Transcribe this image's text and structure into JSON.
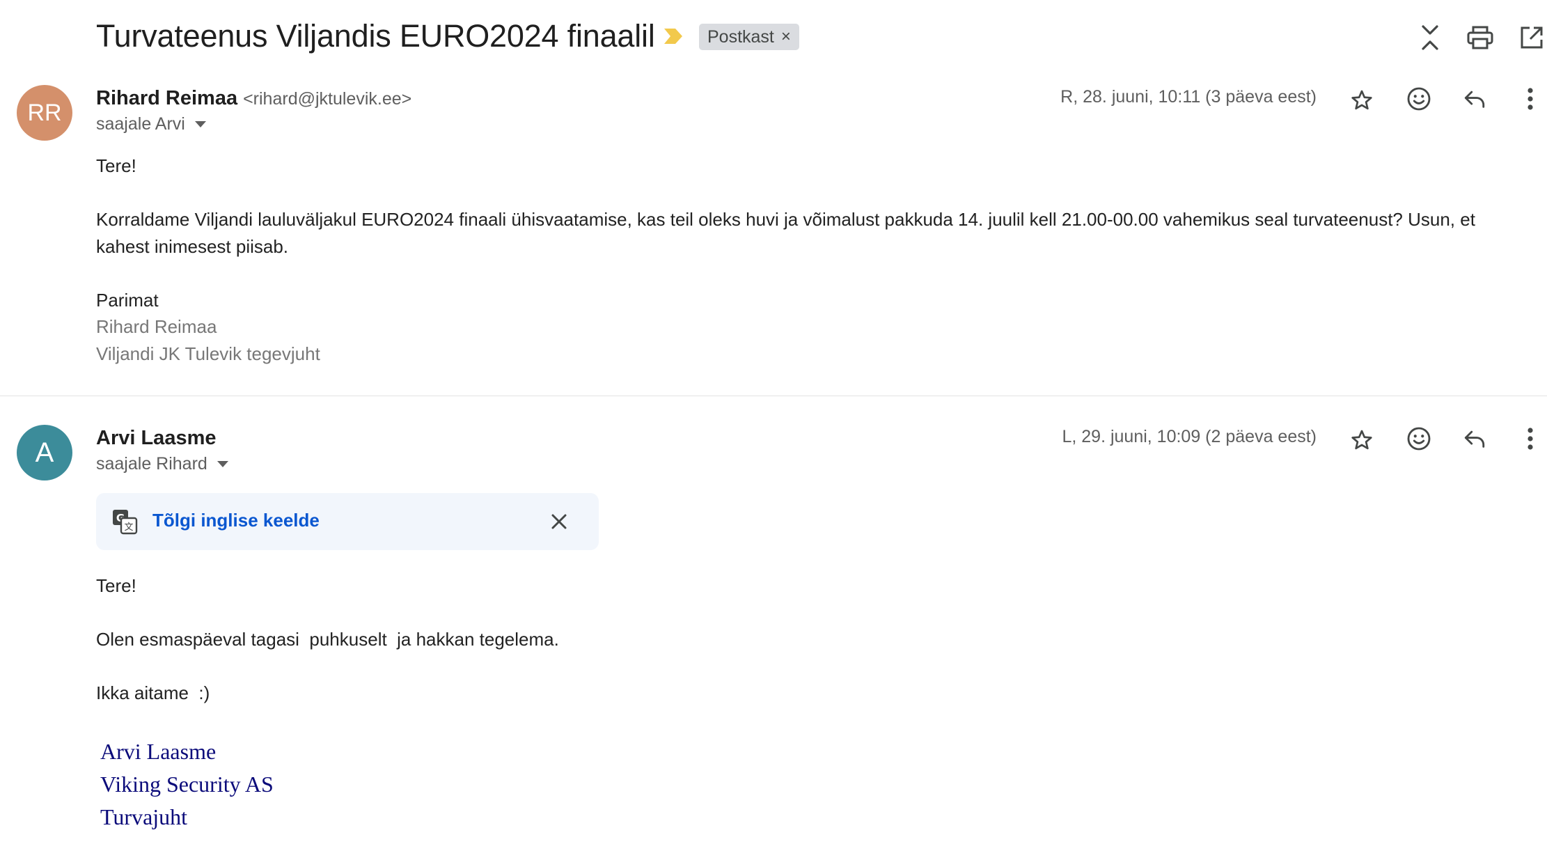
{
  "thread": {
    "subject": "Turvateenus Viljandis EURO2024 finaalil",
    "label": "Postkast",
    "label_remove": "×",
    "toolbar_icons": [
      "collapse-all-icon",
      "print-icon",
      "open-in-new-window-icon"
    ]
  },
  "colors": {
    "avatar_rr": "#d4906b",
    "avatar_a": "#3c8c9a",
    "importance": "#f2c94c",
    "link": "#0b57d0",
    "signature": "#0b0b7a"
  },
  "messages": [
    {
      "avatar_initials": "RR",
      "sender_name": "Rihard Reimaa",
      "sender_email": "<rihard@jktulevik.ee>",
      "recipient": "saajale Arvi",
      "date": "R, 28. juuni, 10:11 (3 päeva eest)",
      "greeting": "Tere!",
      "paragraph_line1": "Korraldame Viljandi lauluväljakul EURO2024 finaali ühisvaatamise, kas teil oleks huvi ja võimalust pakkuda 14. juulil kell 21.00-00.00 vahemikus seal turvateenust? Usun, et",
      "paragraph_line2": "kahest inimesest piisab.",
      "closing": "Parimat",
      "signature_name": "Rihard Reimaa",
      "signature_title": "Viljandi JK Tulevik tegevjuht"
    },
    {
      "avatar_initials": "A",
      "sender_name": "Arvi Laasme",
      "recipient": "saajale Rihard",
      "date": "L, 29. juuni, 10:09 (2 päeva eest)",
      "translate_label": "Tõlgi inglise keelde",
      "greeting": "Tere!",
      "line1": "Olen esmaspäeval tagasi  puhkuselt  ja hakkan tegelema.",
      "line2": "Ikka aitame  :)",
      "signature": [
        "Arvi Laasme",
        "Viking Security AS",
        "Turvajuht"
      ]
    }
  ]
}
